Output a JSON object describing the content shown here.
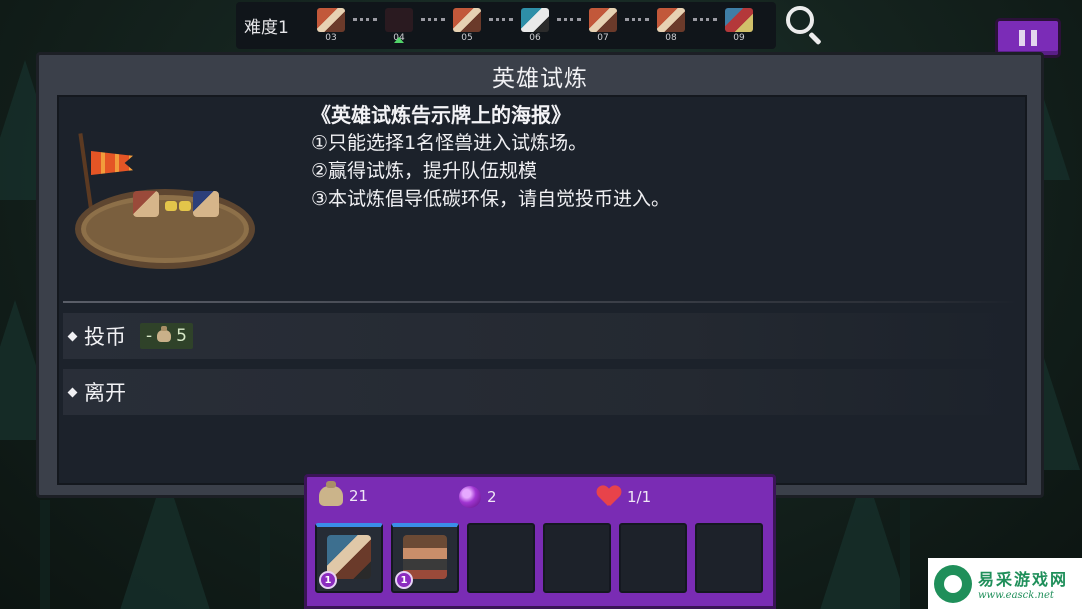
{
  "top_bar": {
    "difficulty_label": "难度1",
    "stages": [
      {
        "num": "03",
        "icon": "monster-group-icon"
      },
      {
        "num": "04",
        "icon": "monster-group-icon",
        "current": true
      },
      {
        "num": "05",
        "icon": "monster-group-icon"
      },
      {
        "num": "06",
        "icon": "event-icon"
      },
      {
        "num": "07",
        "icon": "monster-group-icon"
      },
      {
        "num": "08",
        "icon": "monster-group-icon"
      },
      {
        "num": "09",
        "icon": "boss-icon"
      }
    ],
    "current_marker_color": "#52d36a"
  },
  "panel": {
    "title": "英雄试炼",
    "poster": {
      "title": "《英雄试炼告示牌上的海报》",
      "lines": [
        "①只能选择1名怪兽进入试炼场。",
        "②赢得试炼，提升队伍规模",
        "③本试炼倡导低碳环保，请自觉投币进入。"
      ]
    },
    "options": [
      {
        "label": "投币",
        "cost_prefix": "-",
        "cost_value": "5",
        "cost_icon": "gold-bag-icon"
      },
      {
        "label": "离开"
      }
    ]
  },
  "resources": {
    "gold": "21",
    "gems": "2",
    "hp": "1/1"
  },
  "party": {
    "slots": [
      {
        "filled": true,
        "unit": "bird-warrior-unit",
        "level": "1"
      },
      {
        "filled": true,
        "unit": "masked-brawler-unit",
        "level": "1"
      },
      {
        "filled": false
      },
      {
        "filled": false
      },
      {
        "filled": false
      },
      {
        "filled": false
      }
    ]
  },
  "watermark": {
    "name": "易采游戏网",
    "url": "www.easck.net"
  },
  "colors": {
    "accent_purple": "#7a2cb4",
    "panel_bg": "#3b404a",
    "inner_bg": "#1c222b"
  }
}
